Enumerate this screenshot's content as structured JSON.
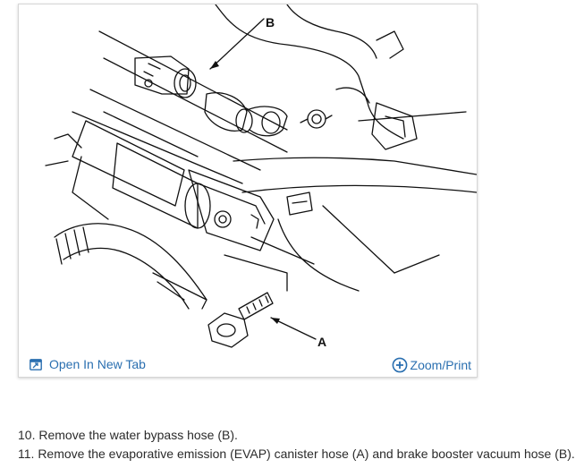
{
  "figure": {
    "callout_a": "A",
    "callout_b": "B",
    "open_link_label": "Open In New Tab",
    "zoom_link_label": "Zoom/Print",
    "open_icon": "open-in-new-tab-icon",
    "zoom_icon": "zoom-plus-icon",
    "link_color": "#2a6fb0"
  },
  "steps": [
    "10. Remove the water bypass hose (B).",
    "11. Remove the evaporative emission (EVAP) canister hose (A) and brake booster vacuum hose (B)."
  ]
}
